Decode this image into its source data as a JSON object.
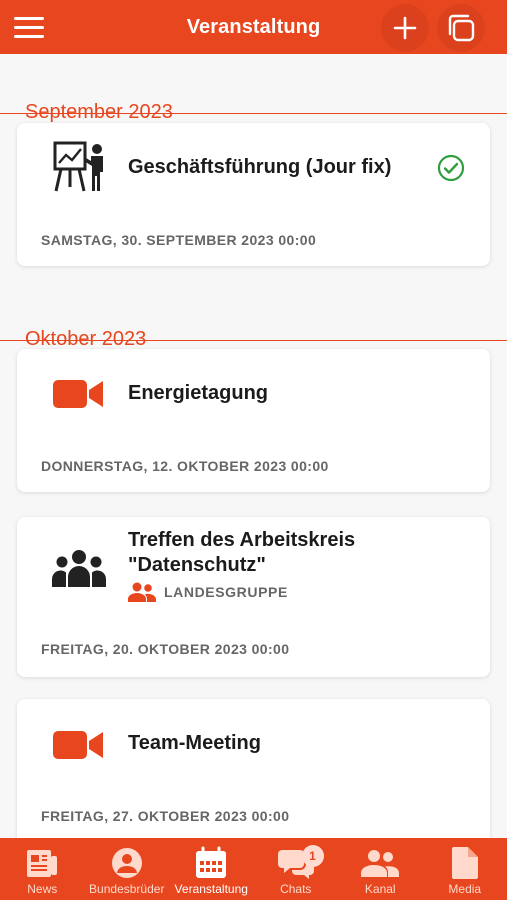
{
  "header": {
    "title": "Veranstaltung",
    "menu_icon": "hamburger-menu-icon",
    "add_icon": "plus-icon",
    "copy_icon": "copy-icon"
  },
  "sections": [
    {
      "month": "September 2023",
      "events": [
        {
          "title": "Geschäftsführung (Jour fix)",
          "date": "SAMSTAG, 30. SEPTEMBER 2023 00:00",
          "icon": "presentation-icon",
          "status_icon": "check-circle-icon"
        }
      ]
    },
    {
      "month": "Oktober 2023",
      "events": [
        {
          "title": "Energietagung",
          "date": "DONNERSTAG, 12. OKTOBER 2023 00:00",
          "icon": "video-camera-icon"
        },
        {
          "title_line1": "Treffen des Arbeitskreis",
          "title_line2": "\"Datenschutz\"",
          "group": "LANDESGRUPPE",
          "date": "FREITAG, 20. OKTOBER 2023 00:00",
          "icon": "group-icon"
        },
        {
          "title": "Team-Meeting",
          "date": "FREITAG, 27. OKTOBER 2023 00:00",
          "icon": "video-camera-icon"
        }
      ]
    }
  ],
  "bottom_nav": [
    {
      "label": "News",
      "icon": "news-icon"
    },
    {
      "label": "Bundesbrüder",
      "icon": "account-icon"
    },
    {
      "label": "Veranstaltung",
      "icon": "calendar-icon",
      "active": true
    },
    {
      "label": "Chats",
      "icon": "chat-icon",
      "badge": "1"
    },
    {
      "label": "Kanal",
      "icon": "people-icon"
    },
    {
      "label": "Media",
      "icon": "file-icon"
    }
  ],
  "colors": {
    "accent": "#e8461e",
    "success": "#2e9e3f",
    "text": "#1b1b1b",
    "muted": "#666666"
  }
}
